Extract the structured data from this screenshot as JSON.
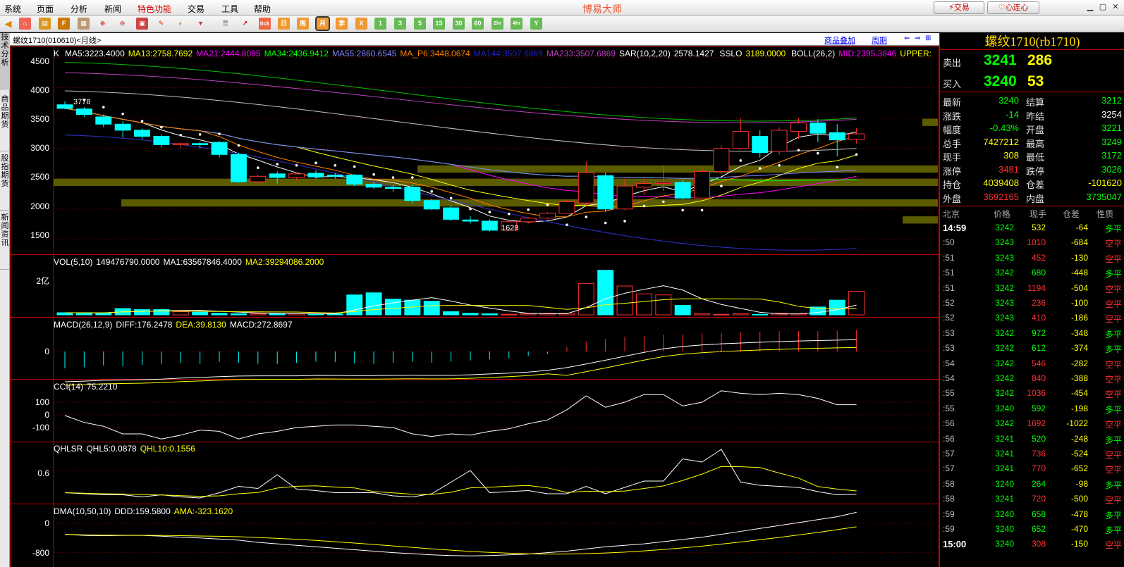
{
  "menu": {
    "items": [
      "系统",
      "页面",
      "分析",
      "新闻",
      "特色功能",
      "交易",
      "工具",
      "帮助"
    ]
  },
  "app": {
    "title": "博易大师",
    "trade_btn": "交易",
    "heart_btn": "心连心"
  },
  "toolbar": {
    "buttons": [
      "tick",
      "日",
      "周",
      "月",
      "季",
      "X",
      "1",
      "3",
      "5",
      "15",
      "30",
      "60",
      "2hr",
      "4hr",
      "Y"
    ]
  },
  "sidetabs": [
    "技术分析",
    "商品期货",
    "股指期货",
    "新闻资讯"
  ],
  "subheader": {
    "symbol": "螺纹1710(010610)<月线>",
    "overlay_link": "商品叠加",
    "period_link": "周期"
  },
  "main_indicators": {
    "k": "K",
    "ma5": "MA5:3223.4000",
    "ma13": "MA13:2758.7692",
    "ma21": "MA21:2444.8095",
    "ma34": "MA34:2436.9412",
    "ma55": "MA55:2860.6545",
    "ma_p6": "MA_P6:3448.0674",
    "ma144": "MA144:3507.6869",
    "ma233": "MA233:3507.6869",
    "sar": "SAR(10,2,20)",
    "sar_val": "2578.1427",
    "sslo": "SSLO",
    "sslo_val": "3189.0000",
    "boll": "BOLL(26,2)",
    "mid": "MID:2395.3846",
    "upper": "UPPER:"
  },
  "y_axis": {
    "main": [
      "4500",
      "4000",
      "3500",
      "3000",
      "2500",
      "2000",
      "1500"
    ],
    "vol": [
      "2亿"
    ],
    "macd": [
      "0"
    ],
    "cci": [
      "100",
      "0",
      "-100"
    ],
    "qhlsr": [
      "0.6"
    ],
    "dma": [
      "0",
      "-800"
    ]
  },
  "annotations": {
    "high": "3778",
    "low": "1628"
  },
  "vol_panel": {
    "name": "VOL(5,10)",
    "val": "149476790.0000",
    "ma1": "MA1:63567846.4000",
    "ma2": "MA2:39294086.2000"
  },
  "macd_panel": {
    "name": "MACD(26,12,9)",
    "diff": "DIFF:176.2478",
    "dea": "DEA:39.8130",
    "macd": "MACD:272.8697"
  },
  "cci_panel": {
    "name": "CCI(14)",
    "val": "75.2210"
  },
  "qhlsr_panel": {
    "name": "QHLSR",
    "qhl5": "QHL5:0.0878",
    "qhl10": "QHL10:0.1556"
  },
  "dma_panel": {
    "name": "DMA(10,50,10)",
    "ddd": "DDD:159.5800",
    "ama": "AMA:-323.1620"
  },
  "quote": {
    "title": "螺纹1710(rb1710)",
    "sell_label": "卖出",
    "sell_price": "3241",
    "sell_vol": "286",
    "buy_label": "买入",
    "buy_price": "3240",
    "buy_vol": "53",
    "rows": [
      {
        "l1": "最新",
        "v1": "3240",
        "c1": "g",
        "l2": "结算",
        "v2": "3212",
        "c2": "g"
      },
      {
        "l1": "涨跌",
        "v1": "-14",
        "c1": "g",
        "l2": "昨结",
        "v2": "3254",
        "c2": "w"
      },
      {
        "l1": "幅度",
        "v1": "-0.43%",
        "c1": "g",
        "l2": "开盘",
        "v2": "3221",
        "c2": "g"
      },
      {
        "l1": "总手",
        "v1": "7427212",
        "c1": "y",
        "l2": "最高",
        "v2": "3249",
        "c2": "g"
      },
      {
        "l1": "现手",
        "v1": "308",
        "c1": "y",
        "l2": "最低",
        "v2": "3172",
        "c2": "g"
      },
      {
        "l1": "涨停",
        "v1": "3481",
        "c1": "r",
        "l2": "跌停",
        "v2": "3026",
        "c2": "g"
      },
      {
        "l1": "持仓",
        "v1": "4039408",
        "c1": "y",
        "l2": "仓差",
        "v2": "-101620",
        "c2": "y"
      },
      {
        "l1": "外盘",
        "v1": "3692165",
        "c1": "r",
        "l2": "内盘",
        "v2": "3735047",
        "c2": "g"
      }
    ],
    "ticks_header": [
      "北京",
      "价格",
      "现手",
      "仓差",
      "性质"
    ],
    "ticks": [
      {
        "t": "14:59",
        "p": "3242",
        "v": "532",
        "vc": "y",
        "d": "-64",
        "n": "多平",
        "nc": "g",
        "bold": true
      },
      {
        "t": ":50",
        "p": "3243",
        "v": "1010",
        "vc": "r",
        "d": "-684",
        "n": "空平",
        "nc": "r"
      },
      {
        "t": ":51",
        "p": "3243",
        "v": "452",
        "vc": "r",
        "d": "-130",
        "n": "空平",
        "nc": "r"
      },
      {
        "t": ":51",
        "p": "3242",
        "v": "680",
        "vc": "g",
        "d": "-448",
        "n": "多平",
        "nc": "g"
      },
      {
        "t": ":51",
        "p": "3242",
        "v": "1194",
        "vc": "r",
        "d": "-504",
        "n": "空平",
        "nc": "r"
      },
      {
        "t": ":52",
        "p": "3243",
        "v": "236",
        "vc": "r",
        "d": "-100",
        "n": "空平",
        "nc": "r"
      },
      {
        "t": ":52",
        "p": "3243",
        "v": "410",
        "vc": "r",
        "d": "-186",
        "n": "空平",
        "nc": "r"
      },
      {
        "t": ":53",
        "p": "3242",
        "v": "972",
        "vc": "g",
        "d": "-348",
        "n": "多平",
        "nc": "g"
      },
      {
        "t": ":53",
        "p": "3242",
        "v": "612",
        "vc": "g",
        "d": "-374",
        "n": "多平",
        "nc": "g"
      },
      {
        "t": ":54",
        "p": "3242",
        "v": "546",
        "vc": "r",
        "d": "-282",
        "n": "空平",
        "nc": "r"
      },
      {
        "t": ":54",
        "p": "3242",
        "v": "840",
        "vc": "r",
        "d": "-388",
        "n": "空平",
        "nc": "r"
      },
      {
        "t": ":55",
        "p": "3242",
        "v": "1036",
        "vc": "r",
        "d": "-454",
        "n": "空平",
        "nc": "r"
      },
      {
        "t": ":55",
        "p": "3240",
        "v": "592",
        "vc": "g",
        "d": "-198",
        "n": "多平",
        "nc": "g"
      },
      {
        "t": ":56",
        "p": "3242",
        "v": "1692",
        "vc": "r",
        "d": "-1022",
        "n": "空平",
        "nc": "r"
      },
      {
        "t": ":56",
        "p": "3241",
        "v": "520",
        "vc": "g",
        "d": "-248",
        "n": "多平",
        "nc": "g"
      },
      {
        "t": ":57",
        "p": "3241",
        "v": "736",
        "vc": "r",
        "d": "-524",
        "n": "空平",
        "nc": "r"
      },
      {
        "t": ":57",
        "p": "3241",
        "v": "770",
        "vc": "r",
        "d": "-652",
        "n": "空平",
        "nc": "r"
      },
      {
        "t": ":58",
        "p": "3240",
        "v": "264",
        "vc": "g",
        "d": "-98",
        "n": "多平",
        "nc": "g"
      },
      {
        "t": ":58",
        "p": "3241",
        "v": "720",
        "vc": "r",
        "d": "-500",
        "n": "空平",
        "nc": "r"
      },
      {
        "t": ":59",
        "p": "3240",
        "v": "658",
        "vc": "g",
        "d": "-478",
        "n": "多平",
        "nc": "g"
      },
      {
        "t": ":59",
        "p": "3240",
        "v": "652",
        "vc": "g",
        "d": "-470",
        "n": "多平",
        "nc": "g"
      },
      {
        "t": "15:00",
        "p": "3240",
        "v": "308",
        "vc": "r",
        "d": "-150",
        "n": "空平",
        "nc": "r",
        "bold": true
      }
    ]
  },
  "chart_data": {
    "type": "candlestick",
    "ylim": [
      1300,
      4600
    ],
    "candles": [
      {
        "o": 3720,
        "h": 3778,
        "l": 3650,
        "c": 3660
      },
      {
        "o": 3650,
        "h": 3680,
        "l": 3520,
        "c": 3560
      },
      {
        "o": 3520,
        "h": 3560,
        "l": 3350,
        "c": 3400
      },
      {
        "o": 3400,
        "h": 3450,
        "l": 3180,
        "c": 3300
      },
      {
        "o": 3300,
        "h": 3330,
        "l": 3150,
        "c": 3200
      },
      {
        "o": 3200,
        "h": 3230,
        "l": 3020,
        "c": 3060
      },
      {
        "o": 3060,
        "h": 3100,
        "l": 3000,
        "c": 3080
      },
      {
        "o": 3080,
        "h": 3110,
        "l": 3000,
        "c": 3060
      },
      {
        "o": 3100,
        "h": 3120,
        "l": 2850,
        "c": 2900
      },
      {
        "o": 2900,
        "h": 2930,
        "l": 2430,
        "c": 2450
      },
      {
        "o": 2450,
        "h": 2560,
        "l": 2420,
        "c": 2540
      },
      {
        "o": 2580,
        "h": 2620,
        "l": 2420,
        "c": 2520
      },
      {
        "o": 2520,
        "h": 2600,
        "l": 2480,
        "c": 2580
      },
      {
        "o": 2590,
        "h": 2640,
        "l": 2500,
        "c": 2530
      },
      {
        "o": 2560,
        "h": 2600,
        "l": 2500,
        "c": 2540
      },
      {
        "o": 2560,
        "h": 2580,
        "l": 2380,
        "c": 2410
      },
      {
        "o": 2410,
        "h": 2450,
        "l": 2330,
        "c": 2360
      },
      {
        "o": 2360,
        "h": 2400,
        "l": 2280,
        "c": 2340
      },
      {
        "o": 2360,
        "h": 2400,
        "l": 2100,
        "c": 2140
      },
      {
        "o": 2140,
        "h": 2170,
        "l": 1980,
        "c": 2000
      },
      {
        "o": 2020,
        "h": 2060,
        "l": 1800,
        "c": 1830
      },
      {
        "o": 1820,
        "h": 1880,
        "l": 1760,
        "c": 1800
      },
      {
        "o": 1800,
        "h": 1830,
        "l": 1628,
        "c": 1650
      },
      {
        "o": 1650,
        "h": 1800,
        "l": 1640,
        "c": 1790
      },
      {
        "o": 1790,
        "h": 1870,
        "l": 1760,
        "c": 1850
      },
      {
        "o": 1850,
        "h": 1950,
        "l": 1830,
        "c": 1930
      },
      {
        "o": 1930,
        "h": 2150,
        "l": 1920,
        "c": 2120
      },
      {
        "o": 2100,
        "h": 2780,
        "l": 2050,
        "c": 2600
      },
      {
        "o": 2550,
        "h": 2600,
        "l": 1950,
        "c": 2000
      },
      {
        "o": 2000,
        "h": 2500,
        "l": 1980,
        "c": 2380
      },
      {
        "o": 2360,
        "h": 2500,
        "l": 2230,
        "c": 2420
      },
      {
        "o": 2420,
        "h": 2720,
        "l": 2300,
        "c": 2440
      },
      {
        "o": 2440,
        "h": 2480,
        "l": 2160,
        "c": 2180
      },
      {
        "o": 2180,
        "h": 2700,
        "l": 2160,
        "c": 2620
      },
      {
        "o": 2620,
        "h": 3050,
        "l": 2560,
        "c": 3000
      },
      {
        "o": 3000,
        "h": 3500,
        "l": 2980,
        "c": 3280
      },
      {
        "o": 3200,
        "h": 3300,
        "l": 2850,
        "c": 2930
      },
      {
        "o": 2950,
        "h": 3350,
        "l": 2900,
        "c": 3300
      },
      {
        "o": 3280,
        "h": 3500,
        "l": 3150,
        "c": 3420
      },
      {
        "o": 3420,
        "h": 3480,
        "l": 3100,
        "c": 3250
      },
      {
        "o": 3260,
        "h": 3400,
        "l": 2870,
        "c": 3140
      },
      {
        "o": 3150,
        "h": 3340,
        "l": 3080,
        "c": 3240
      }
    ],
    "vol": [
      4,
      4,
      3,
      12,
      10,
      10,
      6,
      5,
      3,
      2,
      2,
      2,
      2,
      2,
      2,
      38,
      42,
      30,
      28,
      26,
      6,
      3,
      2,
      1,
      2,
      3,
      3,
      60,
      85,
      55,
      40,
      38,
      18,
      2,
      1,
      2,
      1,
      3,
      2,
      15,
      28,
      45
    ],
    "macd": [
      -30,
      -28,
      -25,
      -26,
      -24,
      -22,
      -20,
      -22,
      -18,
      -20,
      -22,
      -22,
      -20,
      -18,
      -19,
      -21,
      -22,
      -20,
      -18,
      -20,
      -18,
      -16,
      -14,
      -12,
      -8,
      -4,
      8,
      18,
      22,
      26,
      28,
      30,
      30,
      32,
      33,
      34,
      35,
      36,
      36,
      36,
      37,
      38
    ],
    "cci": [
      -5,
      -60,
      -90,
      -150,
      -150,
      -190,
      -160,
      -120,
      -130,
      -190,
      -150,
      -130,
      -100,
      -90,
      -80,
      -80,
      -90,
      -100,
      -150,
      -170,
      -150,
      -160,
      -130,
      -110,
      -70,
      -40,
      40,
      150,
      60,
      100,
      160,
      160,
      70,
      100,
      190,
      170,
      160,
      170,
      160,
      130,
      80,
      80
    ],
    "qhlsr": [
      0.18,
      0.16,
      0.14,
      0.14,
      0.1,
      0.14,
      0.1,
      0.08,
      0.18,
      0.3,
      0.26,
      0.52,
      0.25,
      0.22,
      0.18,
      0.18,
      0.18,
      0.12,
      0.1,
      0.16,
      0.38,
      0.6,
      0.18,
      0.2,
      0.22,
      0.16,
      0.16,
      0.3,
      0.16,
      0.28,
      0.4,
      0.4,
      0.82,
      0.76,
      1.0,
      0.38,
      0.32,
      0.3,
      0.28,
      0.2,
      0.14,
      0.15
    ],
    "dma": [
      -300,
      -330,
      -340,
      -330,
      -330,
      -350,
      -380,
      -400,
      -430,
      -460,
      -520,
      -560,
      -600,
      -640,
      -680,
      -720,
      -760,
      -800,
      -830,
      -860,
      -880,
      -890,
      -880,
      -860,
      -840,
      -800,
      -760,
      -700,
      -640,
      -600,
      -560,
      -500,
      -440,
      -380,
      -300,
      -220,
      -140,
      -60,
      20,
      100,
      180,
      300
    ]
  }
}
